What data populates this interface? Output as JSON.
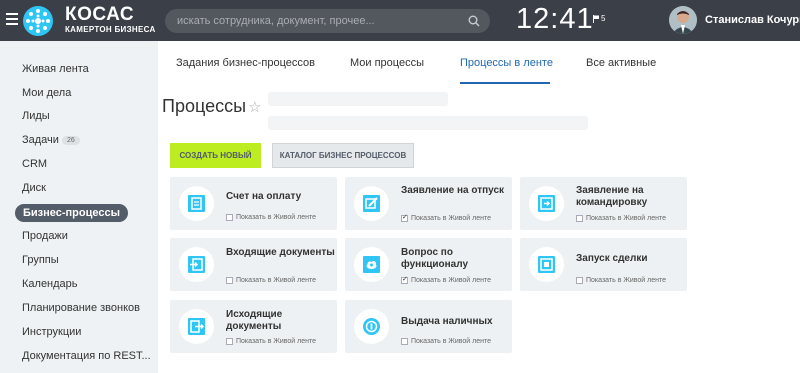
{
  "header": {
    "brand_name": "КОСАС",
    "brand_sub": "КАМЕРТОН БИЗНЕСА",
    "search_placeholder": "искать сотрудника, документ, прочее...",
    "clock": "12:41",
    "flag_count": "5",
    "user_name": "Станислав Кочурин"
  },
  "sidebar": {
    "items": [
      {
        "label": "Живая лента"
      },
      {
        "label": "Мои дела"
      },
      {
        "label": "Лиды"
      },
      {
        "label": "Задачи",
        "badge": "26"
      },
      {
        "label": "CRM"
      },
      {
        "label": "Диск"
      },
      {
        "label": "Бизнес-процессы",
        "active": true
      },
      {
        "label": "Продажи"
      },
      {
        "label": "Группы"
      },
      {
        "label": "Календарь"
      },
      {
        "label": "Планирование звонков"
      },
      {
        "label": "Инструкции"
      },
      {
        "label": "Документация по REST..."
      }
    ]
  },
  "tabs": [
    {
      "label": "Задания бизнес-процессов"
    },
    {
      "label": "Мои процессы"
    },
    {
      "label": "Процессы в ленте",
      "active": true
    },
    {
      "label": "Все активные"
    }
  ],
  "page": {
    "title": "Процессы",
    "create_button": "СОЗДАТЬ НОВЫЙ",
    "catalog_button": "КАТАЛОГ БИЗНЕС ПРОЦЕССОВ"
  },
  "cards": [
    {
      "title": "Счет на оплату",
      "check_label": "Показать в Живой ленте",
      "checked": false,
      "icon": "document-icon"
    },
    {
      "title": "Заявление на отпуск",
      "check_label": "Показать в Живой ленте",
      "checked": true,
      "icon": "pencil-icon"
    },
    {
      "title": "Заявление на командировку",
      "check_label": "Показать в Живой ленте",
      "checked": false,
      "icon": "arrow-right-icon"
    },
    {
      "title": "Входящие документы",
      "check_label": "Показать в Живой ленте",
      "checked": false,
      "icon": "incoming-icon"
    },
    {
      "title": "Вопрос по функционалу",
      "check_label": "Показать в Живой ленте",
      "checked": true,
      "icon": "cloud-icon"
    },
    {
      "title": "Запуск сделки",
      "check_label": "Показать в Живой ленте",
      "checked": false,
      "icon": "square-icon"
    },
    {
      "title": "Исходящие документы",
      "check_label": "Показать в Живой ленте",
      "checked": false,
      "icon": "outgoing-icon"
    },
    {
      "title": "Выдача наличных",
      "check_label": "Показать в Живой ленте",
      "checked": false,
      "icon": "coin-icon"
    }
  ],
  "colors": {
    "header_bg": "#3a3f48",
    "accent_blue": "#2067b0",
    "icon_blue": "#2fc6f6",
    "create_button_bg": "#bbed21"
  }
}
